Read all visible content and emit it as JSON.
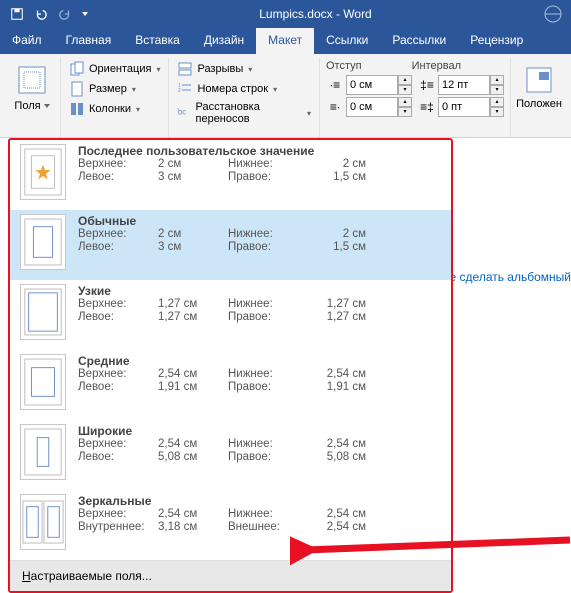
{
  "titlebar": {
    "title": "Lumpics.docx - Word"
  },
  "tabs": {
    "file": "Файл",
    "home": "Главная",
    "insert": "Вставка",
    "design": "Дизайн",
    "layout": "Макет",
    "refs": "Ссылки",
    "mail": "Рассылки",
    "review": "Рецензир"
  },
  "ribbon": {
    "margins": "Поля",
    "orient": "Ориентация",
    "size": "Размер",
    "columns": "Колонки",
    "breaks": "Разрывы",
    "linenums": "Номера строк",
    "hyphen": "Расстановка переносов",
    "indent_label": "Отступ",
    "spacing_label": "Интервал",
    "indent_left": "0 см",
    "indent_right": "0 см",
    "space_before": "12 пт",
    "space_after": "0 пт",
    "position": "Положен"
  },
  "gallery": {
    "options": [
      {
        "name": "Последнее пользовательское значение",
        "tl_label": "Верхнее:",
        "tl": "2 см",
        "tr_label": "Нижнее:",
        "tr": "2 см",
        "bl_label": "Левое:",
        "bl": "3 см",
        "br_label": "Правое:",
        "br": "1,5 см",
        "icon": "star"
      },
      {
        "name": "Обычные",
        "tl_label": "Верхнее:",
        "tl": "2 см",
        "tr_label": "Нижнее:",
        "tr": "2 см",
        "bl_label": "Левое:",
        "bl": "3 см",
        "br_label": "Правое:",
        "br": "1,5 см",
        "icon": "normal"
      },
      {
        "name": "Узкие",
        "tl_label": "Верхнее:",
        "tl": "1,27 см",
        "tr_label": "Нижнее:",
        "tr": "1,27 см",
        "bl_label": "Левое:",
        "bl": "1,27 см",
        "br_label": "Правое:",
        "br": "1,27 см",
        "icon": "narrow"
      },
      {
        "name": "Средние",
        "tl_label": "Верхнее:",
        "tl": "2,54 см",
        "tr_label": "Нижнее:",
        "tr": "2,54 см",
        "bl_label": "Левое:",
        "bl": "1,91 см",
        "br_label": "Правое:",
        "br": "1,91 см",
        "icon": "moderate"
      },
      {
        "name": "Широкие",
        "tl_label": "Верхнее:",
        "tl": "2,54 см",
        "tr_label": "Нижнее:",
        "tr": "2,54 см",
        "bl_label": "Левое:",
        "bl": "5,08 см",
        "br_label": "Правое:",
        "br": "5,08 см",
        "icon": "wide"
      },
      {
        "name": "Зеркальные",
        "tl_label": "Верхнее:",
        "tl": "2,54 см",
        "tr_label": "Нижнее:",
        "tr": "2,54 см",
        "bl_label": "Внутреннее:",
        "bl": "3,18 см",
        "br_label": "Внешнее:",
        "br": "2,54 см",
        "icon": "mirror"
      }
    ],
    "custom": "астраиваемые поля...",
    "custom_u": "Н"
  },
  "link_text": "е сделать альбомный"
}
